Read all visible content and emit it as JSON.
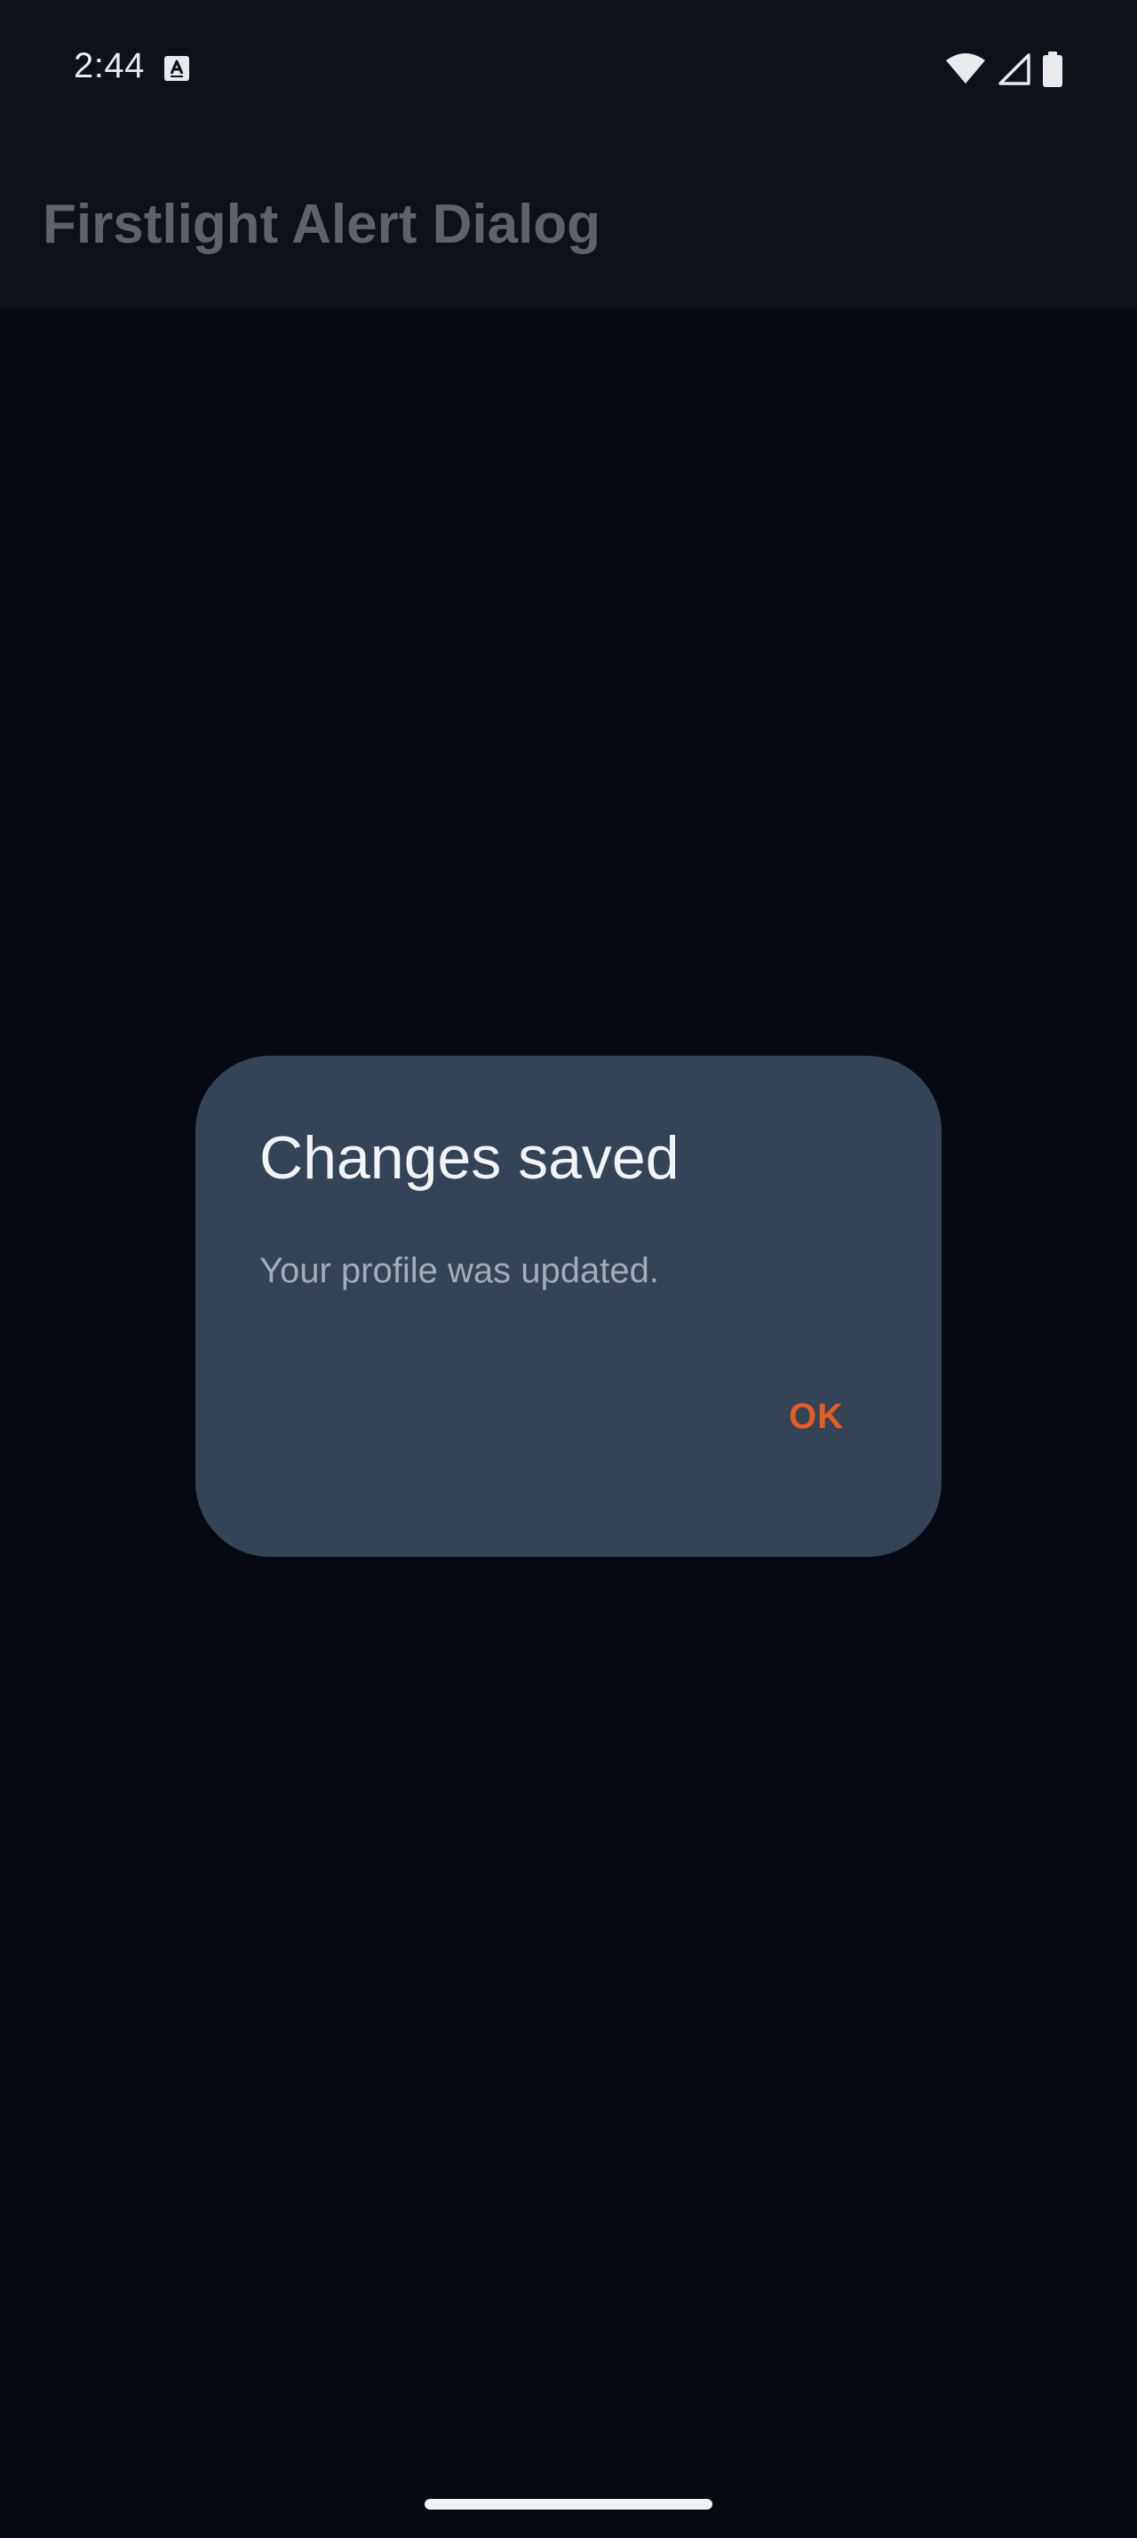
{
  "status_bar": {
    "time": "2:44",
    "icons": [
      "text-notification-icon",
      "wifi-icon",
      "cell-signal-icon",
      "battery-icon"
    ]
  },
  "app_bar": {
    "title": "Firstlight Alert Dialog"
  },
  "dialog": {
    "title": "Changes saved",
    "message": "Your profile was updated.",
    "ok_label": "OK"
  },
  "colors": {
    "background": "#060912",
    "app_bar": "#0d1119",
    "dialog_surface": "#344356",
    "accent": "#e35d23",
    "dialog_title": "#f1f3f6",
    "dialog_message": "#a3acb8",
    "app_title": "#5f6268"
  }
}
